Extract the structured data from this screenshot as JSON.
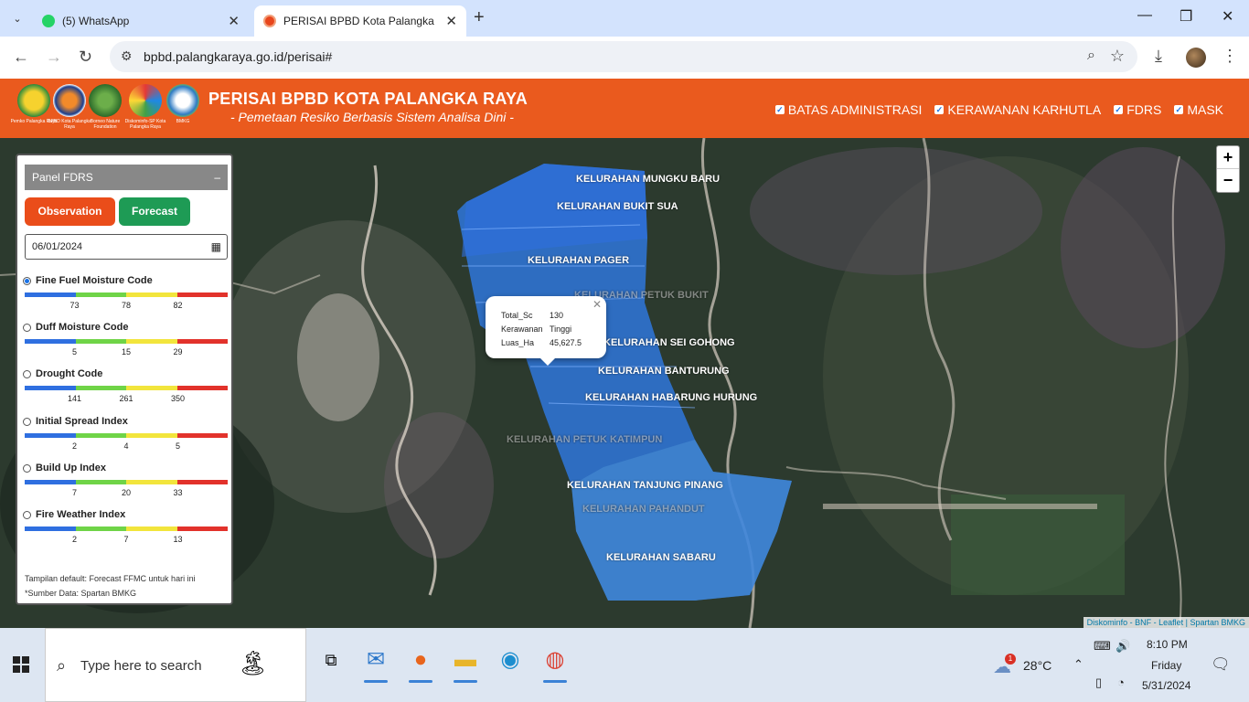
{
  "browser": {
    "tabs": [
      {
        "title": "(5) WhatsApp",
        "active": false
      },
      {
        "title": "PERISAI BPBD Kota Palangka Raya",
        "active": true
      }
    ],
    "url": "bpbd.palangkaraya.go.id/perisai#"
  },
  "header": {
    "logos": [
      "Pemko Palangka Raya",
      "BPBD Kota Palangka Raya",
      "Borneo Nature Foundation",
      "Diskominfo-SP Kota Palangka Raya",
      "BMKG"
    ],
    "title": "PERISAI BPBD KOTA PALANGKA RAYA",
    "subtitle": "- Pemetaan Resiko Berbasis Sistem Analisa Dini -",
    "layers": [
      "BATAS ADMINISTRASI",
      "KERAWANAN KARHUTLA",
      "FDRS",
      "MASK"
    ]
  },
  "map": {
    "kelurahan": [
      {
        "name": "KELURAHAN MUNGKU BARU",
        "faded": false
      },
      {
        "name": "KELURAHAN BUKIT SUA",
        "faded": false
      },
      {
        "name": "KELURAHAN PAGER",
        "faded": false
      },
      {
        "name": "KELURAHAN PETUK BUKIT",
        "faded": true
      },
      {
        "name": "KELURAHAN SEI GOHONG",
        "faded": false
      },
      {
        "name": "KELURAHAN BANTURUNG",
        "faded": false
      },
      {
        "name": "KELURAHAN HABARUNG HURUNG",
        "faded": false
      },
      {
        "name": "KELURAHAN PETUK KATIMPUN",
        "faded": true
      },
      {
        "name": "KELURAHAN TANJUNG PINANG",
        "faded": false
      },
      {
        "name": "KELURAHAN PAHANDUT",
        "faded": true
      },
      {
        "name": "KELURAHAN SABARU",
        "faded": false
      }
    ],
    "popup": {
      "rows": [
        {
          "key": "Total_Sc",
          "value": "130"
        },
        {
          "key": "Kerawanan",
          "value": "Tinggi"
        },
        {
          "key": "Luas_Ha",
          "value": "45,627.5"
        }
      ]
    },
    "zoom_in": "+",
    "zoom_out": "−",
    "attribution": "Diskominfo - BNF - Leaflet | Spartan BMKG"
  },
  "panel": {
    "title": "Panel FDRS",
    "minimize": "–",
    "observation_label": "Observation",
    "forecast_label": "Forecast",
    "date": "06/01/2024",
    "indices": [
      {
        "name": "Fine Fuel Moisture Code",
        "selected": true,
        "ticks": [
          "73",
          "78",
          "82"
        ]
      },
      {
        "name": "Duff Moisture Code",
        "selected": false,
        "ticks": [
          "5",
          "15",
          "29"
        ]
      },
      {
        "name": "Drought Code",
        "selected": false,
        "ticks": [
          "141",
          "261",
          "350"
        ]
      },
      {
        "name": "Initial Spread Index",
        "selected": false,
        "ticks": [
          "2",
          "4",
          "5"
        ]
      },
      {
        "name": "Build Up Index",
        "selected": false,
        "ticks": [
          "7",
          "20",
          "33"
        ]
      },
      {
        "name": "Fire Weather Index",
        "selected": false,
        "ticks": [
          "2",
          "7",
          "13"
        ]
      }
    ],
    "bar_colors": [
      "#2f6fe0",
      "#6fd447",
      "#f2e53c",
      "#e2322b"
    ],
    "note1": "Tampilan default: Forecast FFMC untuk hari ini",
    "note2": "*Sumber Data: Spartan BMKG"
  },
  "taskbar": {
    "search_placeholder": "Type here to search",
    "weather_temp": "28°C",
    "weather_badge": "1",
    "time": "8:10 PM",
    "day": "Friday",
    "date": "5/31/2024"
  }
}
